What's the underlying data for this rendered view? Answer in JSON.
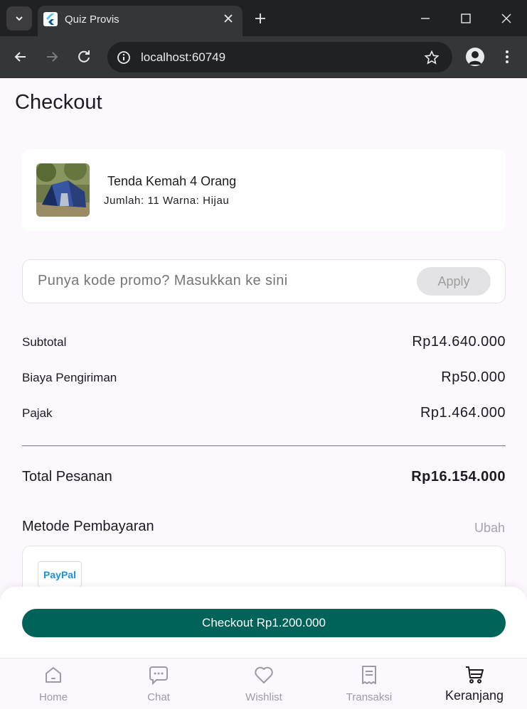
{
  "browser": {
    "tab_title": "Quiz Provis",
    "url": "localhost:60749"
  },
  "page": {
    "title": "Checkout"
  },
  "product": {
    "name": "Tenda Kemah 4 Orang",
    "meta": "Jumlah: 11 Warna: Hijau"
  },
  "promo": {
    "placeholder": "Punya kode promo? Masukkan ke sini",
    "apply_label": "Apply"
  },
  "summary": {
    "subtotal_label": "Subtotal",
    "subtotal_value": "Rp14.640.000",
    "shipping_label": "Biaya Pengiriman",
    "shipping_value": "Rp50.000",
    "tax_label": "Pajak",
    "tax_value": "Rp1.464.000",
    "total_label": "Total Pesanan",
    "total_value": "Rp16.154.000"
  },
  "payment": {
    "title": "Metode Pembayaran",
    "change_label": "Ubah",
    "method_logo": "PayPal"
  },
  "checkout": {
    "button_label": "Checkout Rp1.200.000"
  },
  "bottom_nav": {
    "items": [
      {
        "label": "Home",
        "icon": "home-icon"
      },
      {
        "label": "Chat",
        "icon": "chat-icon"
      },
      {
        "label": "Wishlist",
        "icon": "heart-icon"
      },
      {
        "label": "Transaksi",
        "icon": "receipt-icon"
      },
      {
        "label": "Keranjang",
        "icon": "cart-icon"
      }
    ],
    "active_index": 4
  },
  "colors": {
    "primary": "#00635a",
    "background": "#fdf7fe",
    "paypal": "#1a8fe3"
  }
}
